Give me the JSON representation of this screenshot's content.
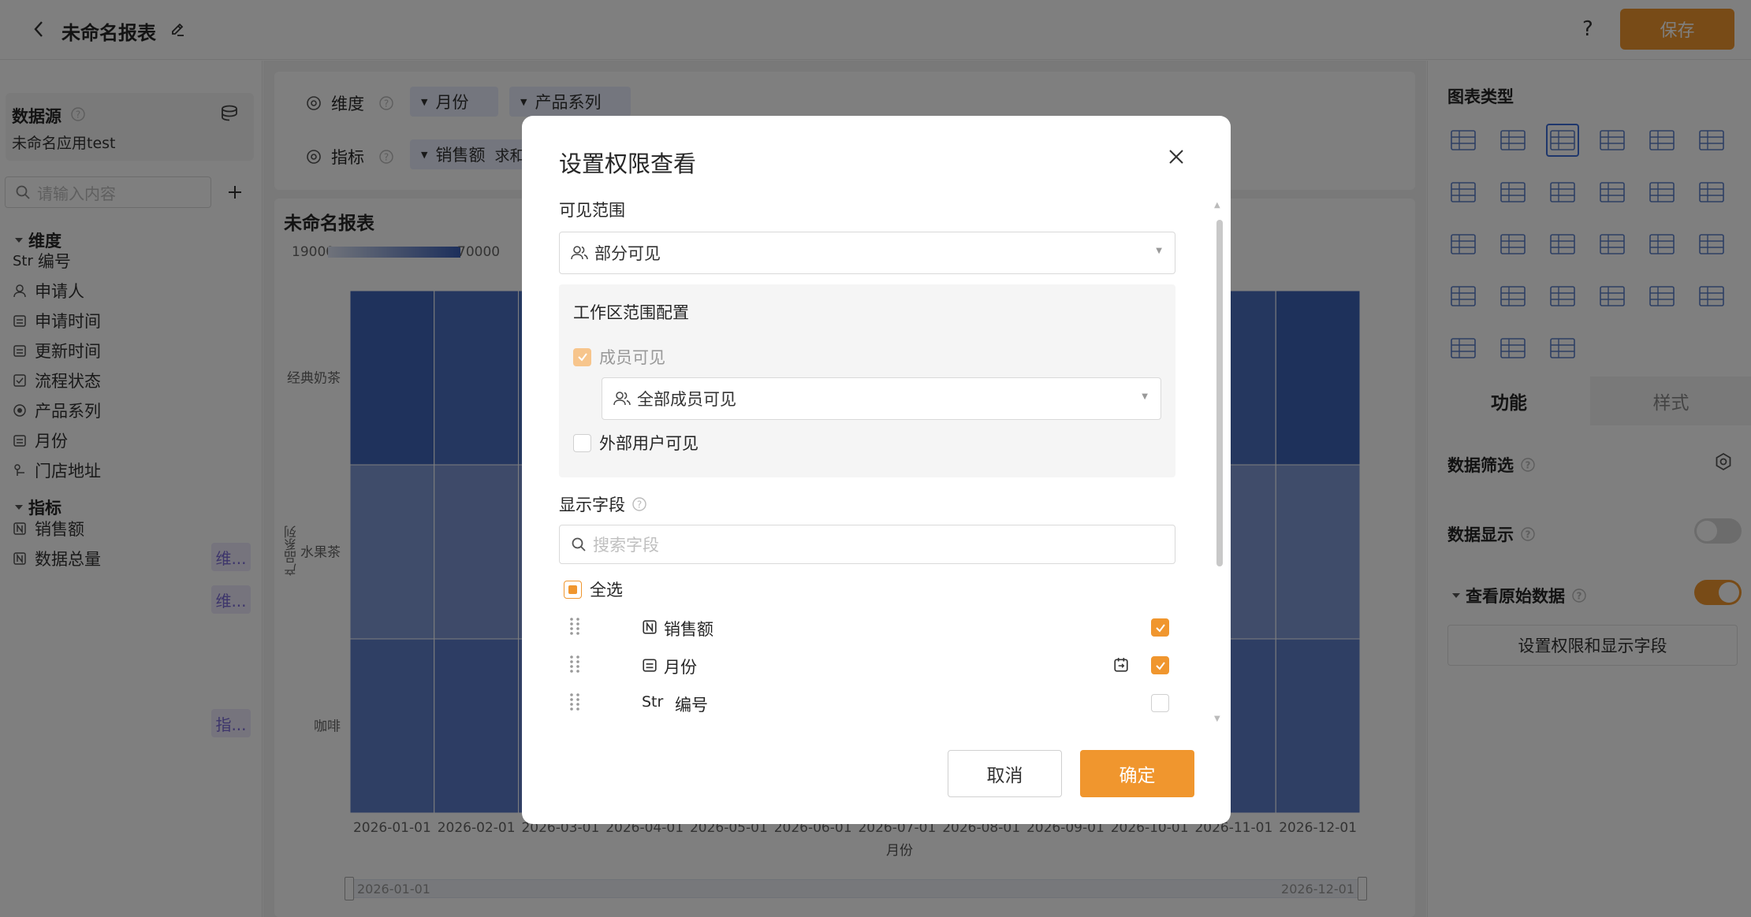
{
  "header": {
    "title": "未命名报表",
    "help_label": "?",
    "save_label": "保存"
  },
  "sidebar": {
    "datasource_label": "数据源",
    "app_name": "未命名应用test",
    "search_placeholder": "请输入内容",
    "dimension_title": "维度",
    "measure_title": "指标",
    "dimensions": [
      {
        "prefix": "Str",
        "label": "编号",
        "icon": "string-icon"
      },
      {
        "label": "申请人",
        "icon": "person-icon"
      },
      {
        "label": "申请时间",
        "icon": "calendar-icon"
      },
      {
        "label": "更新时间",
        "icon": "calendar-icon"
      },
      {
        "label": "流程状态",
        "icon": "checkbox-icon"
      },
      {
        "label": "产品系列",
        "icon": "radio-icon",
        "tag": "维..."
      },
      {
        "label": "月份",
        "icon": "calendar-icon",
        "tag": "维..."
      },
      {
        "label": "门店地址",
        "icon": "location-icon"
      }
    ],
    "measures": [
      {
        "label": "销售额",
        "icon": "number-icon",
        "tag": "指..."
      },
      {
        "label": "数据总量",
        "icon": "number-icon"
      }
    ]
  },
  "config": {
    "dimension_label": "维度",
    "dimension_pills": [
      "月份",
      "产品系列"
    ],
    "measure_label": "指标",
    "measure_pill": "销售额",
    "measure_agg": "求和"
  },
  "chart": {
    "title": "未命名报表",
    "legend_min": "19000",
    "legend_max": "70000",
    "y_axis_label": "产品系列",
    "x_axis_label": "月份",
    "range_start": "2026-01-01",
    "range_end": "2026-12-01"
  },
  "chart_data": {
    "type": "heatmap",
    "x": [
      "2026-01-01",
      "2026-02-01",
      "2026-03-01",
      "2026-04-01",
      "2026-05-01",
      "2026-06-01",
      "2026-07-01",
      "2026-08-01",
      "2026-09-01",
      "2026-10-01",
      "2026-11-01",
      "2026-12-01"
    ],
    "y": [
      "经典奶茶",
      "水果茶",
      "咖啡"
    ],
    "xlabel": "月份",
    "ylabel": "产品系列",
    "value_range": [
      19000,
      70000
    ]
  },
  "right": {
    "chart_type_title": "图表类型",
    "tab_function": "功能",
    "tab_style": "样式",
    "filter_label": "数据筛选",
    "display_label": "数据显示",
    "raw_label": "查看原始数据",
    "perm_button": "设置权限和显示字段",
    "accent": "#f0962e"
  },
  "modal": {
    "title": "设置权限查看",
    "visible_scope_label": "可见范围",
    "scope_value": "部分可见",
    "workspace_title": "工作区范围配置",
    "member_visible": "成员可见",
    "member_scope_value": "全部成员可见",
    "external_visible": "外部用户可见",
    "display_fields_label": "显示字段",
    "search_placeholder": "搜索字段",
    "select_all": "全选",
    "fields": [
      {
        "label": "销售额",
        "icon": "number-icon",
        "checked": true
      },
      {
        "label": "月份",
        "icon": "calendar-icon",
        "checked": true
      },
      {
        "prefix": "Str",
        "label": "编号",
        "checked": false
      }
    ],
    "cancel_label": "取消",
    "confirm_label": "确定"
  }
}
